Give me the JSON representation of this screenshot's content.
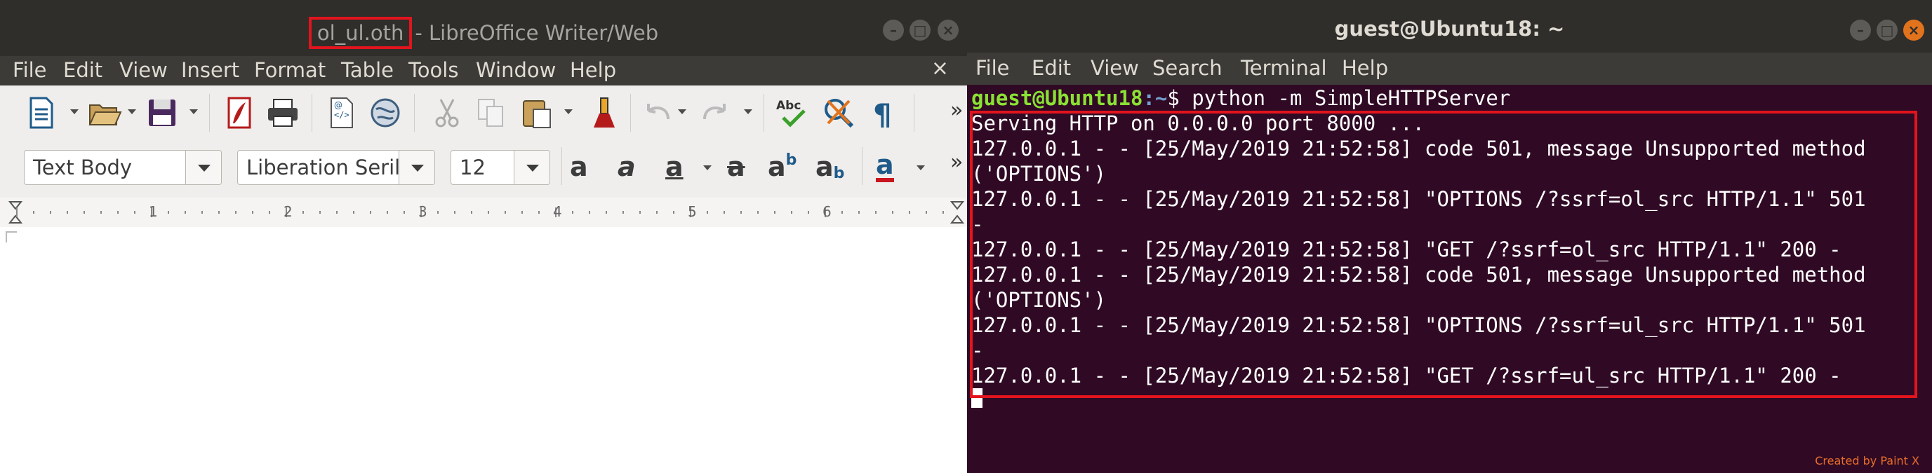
{
  "writer": {
    "title_doc": "ol_ul.oth",
    "title_app": "- LibreOffice Writer/Web",
    "menu": [
      "File",
      "Edit",
      "View",
      "Insert",
      "Format",
      "Table",
      "Tools",
      "Window",
      "Help"
    ],
    "close_glyph": "×",
    "paragraph_style": "Text Body",
    "font_name": "Liberation Seril",
    "font_size": "12",
    "ruler_numbers": [
      "1",
      "2",
      "3",
      "4",
      "5",
      "6"
    ],
    "more_glyph": "»"
  },
  "terminal": {
    "title": "guest@Ubuntu18: ~",
    "menu": [
      "File",
      "Edit",
      "View",
      "Search",
      "Terminal",
      "Help"
    ],
    "prompt_user": "guest@Ubuntu18",
    "prompt_path": ":~",
    "prompt_symbol": "$",
    "command": " python -m SimpleHTTPServer",
    "lines": [
      "Serving HTTP on 0.0.0.0 port 8000 ...",
      "127.0.0.1 - - [25/May/2019 21:52:58] code 501, message Unsupported method",
      "('OPTIONS')",
      "127.0.0.1 - - [25/May/2019 21:52:58] \"OPTIONS /?ssrf=ol_src HTTP/1.1\" 501",
      "-",
      "127.0.0.1 - - [25/May/2019 21:52:58] \"GET /?ssrf=ol_src HTTP/1.1\" 200 -",
      "127.0.0.1 - - [25/May/2019 21:52:58] code 501, message Unsupported method",
      "('OPTIONS')",
      "127.0.0.1 - - [25/May/2019 21:52:58] \"OPTIONS /?ssrf=ul_src HTTP/1.1\" 501",
      "-",
      "127.0.0.1 - - [25/May/2019 21:52:58] \"GET /?ssrf=ul_src HTTP/1.1\" 200 -"
    ],
    "credit": "Created by Paint X"
  },
  "colors": {
    "highlight_red": "#e2141d",
    "terminal_bg": "#300a24",
    "prompt_green": "#8ae234",
    "prompt_blue": "#729fcf"
  }
}
